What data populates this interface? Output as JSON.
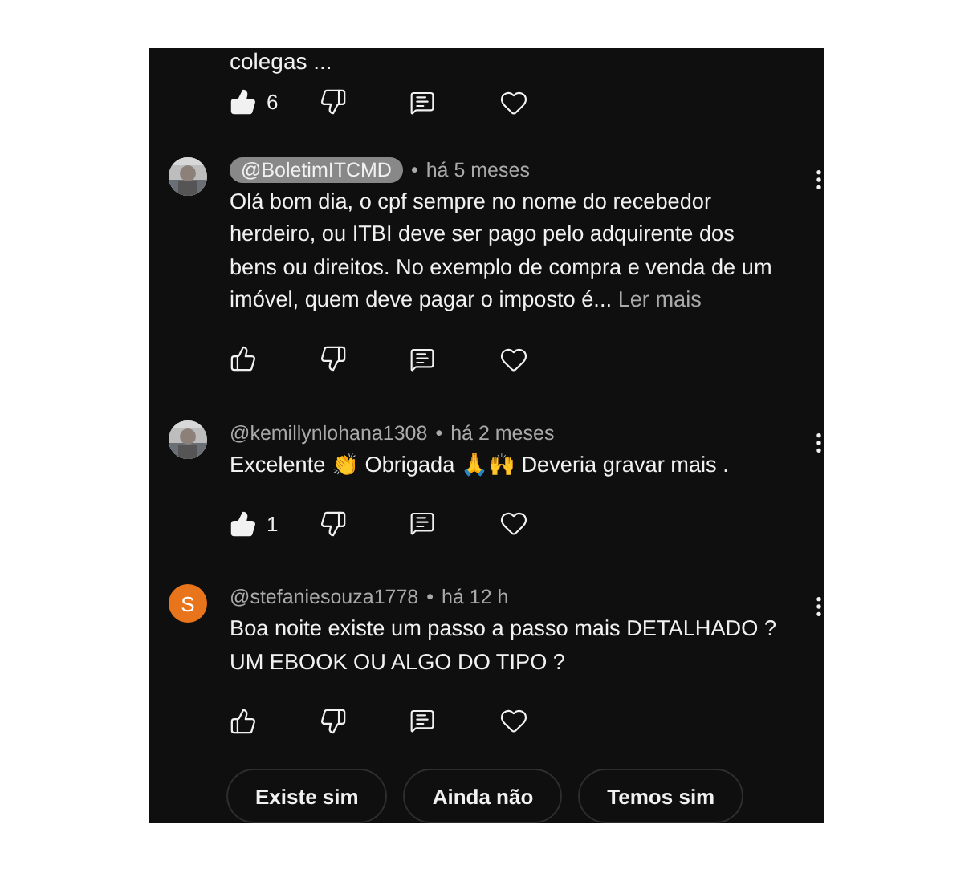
{
  "previous_comment": {
    "text_tail": "colegas ...",
    "actions": {
      "liked": true,
      "like_count": "6"
    }
  },
  "comments": [
    {
      "author": "@BoletimITCMD",
      "highlighted": true,
      "time": "há 5 meses",
      "text": "Olá bom dia, o cpf sempre no nome do recebedor herdeiro, ou ITBI deve ser pago pelo adquirente dos bens ou direitos. No exemplo de compra e venda de um imóvel, quem deve pagar o imposto é...",
      "read_more": "Ler mais",
      "liked": false
    },
    {
      "author": "@kemillynlohana1308",
      "highlighted": false,
      "time": "há 2 meses",
      "text": "Excelente 👏 Obrigada 🙏🙌 Deveria gravar mais .",
      "liked": true,
      "like_count": "1"
    },
    {
      "avatar": {
        "kind": "letter",
        "letter": "S",
        "color": "#e8741c"
      },
      "author": "@stefaniesouza1778",
      "highlighted": false,
      "time": "há 12 h",
      "text": "Boa noite existe um passo a passo mais DETALHADO ? UM EBOOK OU ALGO DO TIPO ?",
      "liked": false
    }
  ],
  "separator": "•",
  "suggested_replies": [
    "Existe sim",
    "Ainda não",
    "Temos sim"
  ]
}
